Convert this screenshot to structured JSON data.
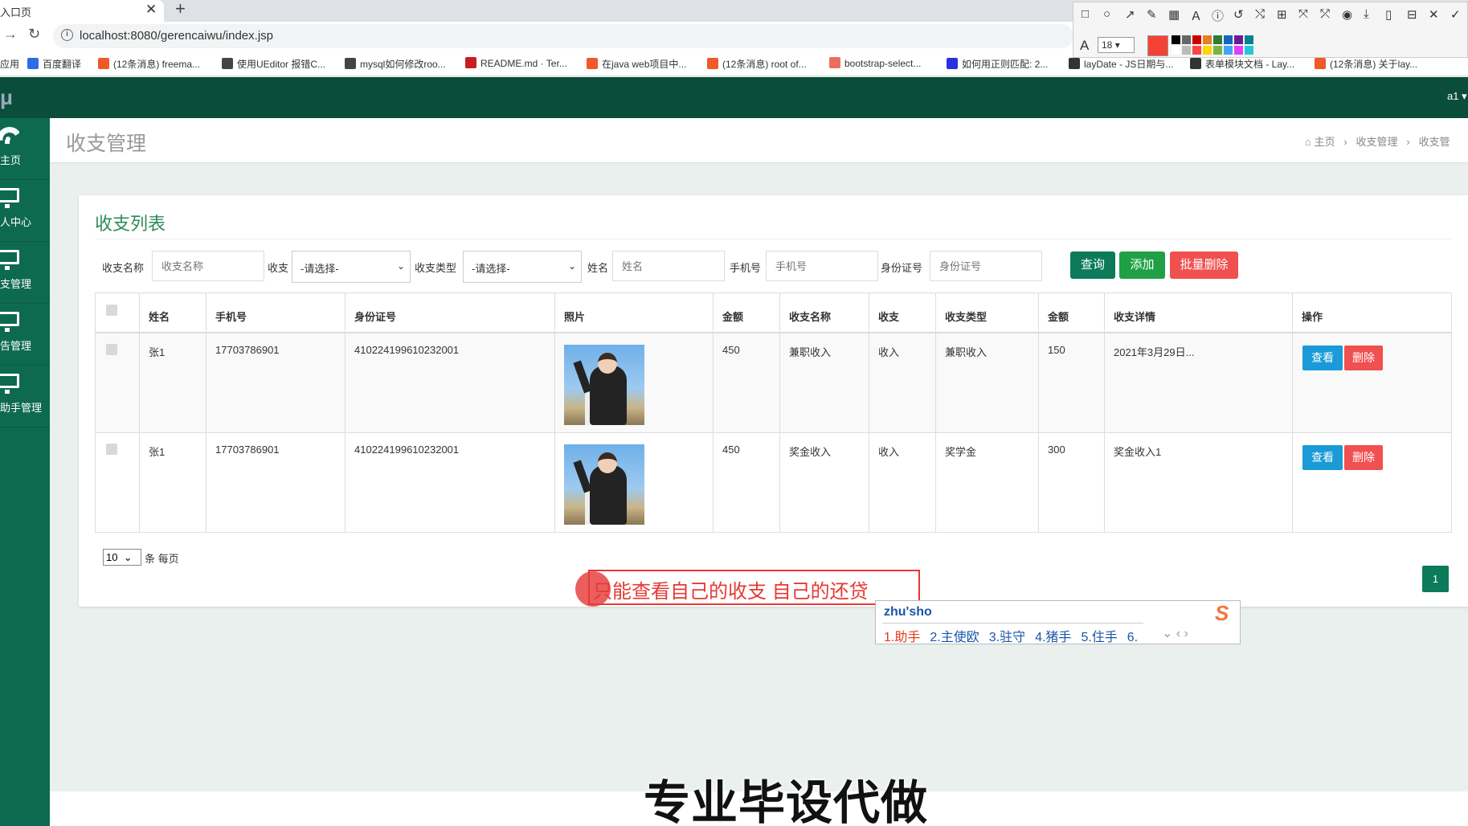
{
  "browser": {
    "tab_title": "入口页",
    "url": "localhost:8080/gerencaiwu/index.jsp",
    "bookmarks": [
      {
        "label": "应用",
        "icon": "apps-icon",
        "color": "#4285f4"
      },
      {
        "label": "百度翻译",
        "icon": "baidu-translate-icon",
        "color": "#2b6de5"
      },
      {
        "label": "(12条消息) freema...",
        "icon": "csdn-icon",
        "color": "#f05a28"
      },
      {
        "label": "使用UEditor 报错C...",
        "icon": "cnblogs-icon",
        "color": "#444"
      },
      {
        "label": "mysql如何修改roo...",
        "icon": "cnblogs-icon",
        "color": "#444"
      },
      {
        "label": "README.md · Ter...",
        "icon": "gitee-icon",
        "color": "#c71d23"
      },
      {
        "label": "在java web项目中...",
        "icon": "csdn-icon",
        "color": "#f05a28"
      },
      {
        "label": "(12条消息) root of...",
        "icon": "csdn-icon",
        "color": "#f05a28"
      },
      {
        "label": "bootstrap-select...",
        "icon": "jianshu-icon",
        "color": "#ea6f5a"
      },
      {
        "label": "如何用正则匹配: 2...",
        "icon": "baidu-icon",
        "color": "#2932e1"
      },
      {
        "label": "layDate - JS日期与...",
        "icon": "layui-icon",
        "color": "#333"
      },
      {
        "label": "表单模块文档 - Lay...",
        "icon": "layui-icon",
        "color": "#333"
      },
      {
        "label": "(12条消息) 关于lay...",
        "icon": "csdn-icon",
        "color": "#f05a28"
      }
    ]
  },
  "snip_toolbar": {
    "font_size": "18",
    "tools": [
      "rect-tool-icon",
      "ellipse-tool-icon",
      "arrow-tool-icon",
      "pen-tool-icon",
      "mosaic-tool-icon",
      "text-tool-icon",
      "number-tool-icon",
      "undo-icon",
      "pin-icon",
      "ocr-icon",
      "translate-icon",
      "shape-icon",
      "record-icon",
      "download-icon",
      "save-icon",
      "bookmark-icon",
      "close-icon",
      "confirm-icon"
    ],
    "active_color": "#f44336"
  },
  "app": {
    "logo": "μ",
    "user": "a1 ▾"
  },
  "sidebar": {
    "items": [
      {
        "label": "主页",
        "icon": "dashboard-icon"
      },
      {
        "label": "人中心",
        "icon": "monitor-icon"
      },
      {
        "label": "支管理",
        "icon": "monitor-icon"
      },
      {
        "label": "告管理",
        "icon": "monitor-icon"
      },
      {
        "label": "助手管理",
        "icon": "monitor-icon"
      }
    ]
  },
  "page": {
    "title": "收支管理",
    "breadcrumb": [
      "主页",
      "收支管理",
      "收支管"
    ]
  },
  "list": {
    "title": "收支列表",
    "filters": {
      "name_label": "收支名称",
      "name_placeholder": "收支名称",
      "shouzhi_label": "收支",
      "shouzhi_value": "-请选择-",
      "type_label": "收支类型",
      "type_value": "-请选择-",
      "xingming_label": "姓名",
      "xingming_placeholder": "姓名",
      "phone_label": "手机号",
      "phone_placeholder": "手机号",
      "idcard_label": "身份证号",
      "idcard_placeholder": "身份证号"
    },
    "buttons": {
      "query": "查询",
      "add": "添加",
      "batch_delete": "批量删除"
    },
    "columns": [
      "姓名",
      "手机号",
      "身份证号",
      "照片",
      "金额",
      "收支名称",
      "收支",
      "收支类型",
      "金额",
      "收支详情",
      "操作"
    ],
    "rows": [
      {
        "name": "张1",
        "phone": "17703786901",
        "idcard": "410224199610232001",
        "amount1": "450",
        "item_name": "兼职收入",
        "direction": "收入",
        "type": "兼职收入",
        "amount2": "150",
        "detail": "2021年3月29日...",
        "view": "查看",
        "delete": "删除"
      },
      {
        "name": "张1",
        "phone": "17703786901",
        "idcard": "410224199610232001",
        "amount1": "450",
        "item_name": "奖金收入",
        "direction": "收入",
        "type": "奖学金",
        "amount2": "300",
        "detail": "奖金收入1",
        "view": "查看",
        "delete": "删除"
      }
    ],
    "page_size": "10",
    "page_size_label": "条 每页",
    "current_page": "1"
  },
  "annotation": {
    "text": "只能查看自己的收支  自己的还贷"
  },
  "ime": {
    "input": "zhu'sho",
    "candidates": [
      "1.助手",
      "2.主使欧",
      "3.驻守",
      "4.猪手",
      "5.住手",
      "6."
    ]
  },
  "watermark": "专业毕设代做"
}
